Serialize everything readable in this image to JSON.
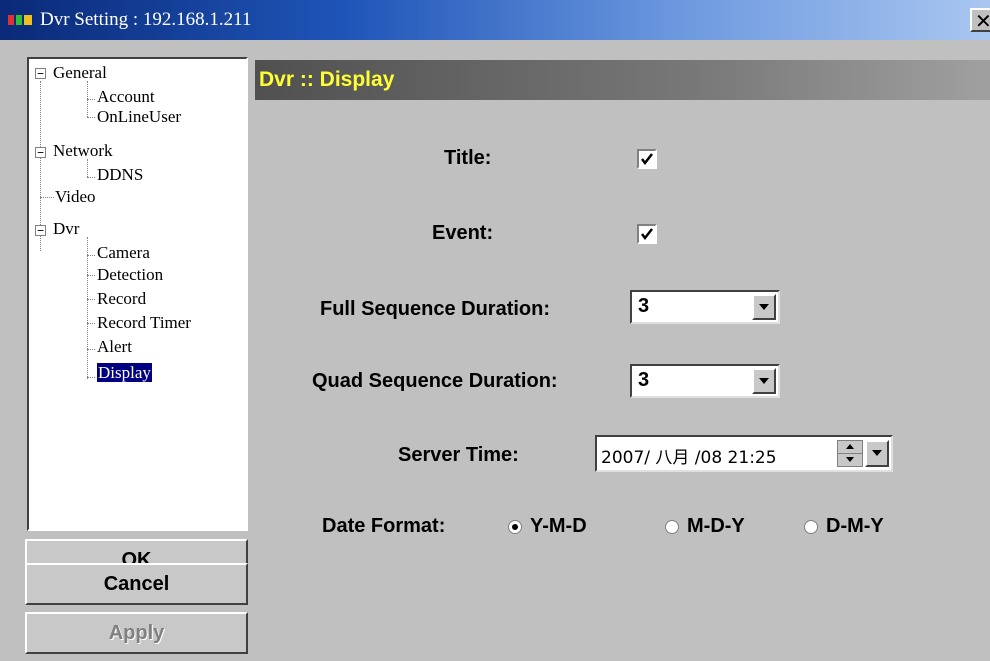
{
  "window": {
    "title": "Dvr Setting : 192.168.1.211",
    "close_glyph": "✕"
  },
  "tree": {
    "items": [
      {
        "label": "General",
        "expander": "−"
      },
      {
        "label": "Account"
      },
      {
        "label": "OnLineUser"
      },
      {
        "label": "Network",
        "expander": "−"
      },
      {
        "label": "DDNS"
      },
      {
        "label": "Video"
      },
      {
        "label": "Dvr",
        "expander": "−"
      },
      {
        "label": "Camera"
      },
      {
        "label": "Detection"
      },
      {
        "label": "Record"
      },
      {
        "label": "Record Timer"
      },
      {
        "label": "Alert"
      },
      {
        "label": "Display",
        "selected": true
      }
    ]
  },
  "buttons": {
    "ok": "OK",
    "cancel": "Cancel",
    "apply": "Apply"
  },
  "panel": {
    "header": "Dvr :: Display",
    "title_label": "Title:",
    "title_checked": true,
    "event_label": "Event:",
    "event_checked": true,
    "full_seq_label": "Full Sequence Duration:",
    "full_seq_value": "3",
    "quad_seq_label": "Quad Sequence Duration:",
    "quad_seq_value": "3",
    "server_time_label": "Server Time:",
    "server_time_value": "2007/ 八月 /08 21:25",
    "date_format_label": "Date Format:",
    "date_format_options": [
      "Y-M-D",
      "M-D-Y",
      "D-M-Y"
    ],
    "date_format_selected": "Y-M-D"
  },
  "colors": {
    "titlebar_start": "#0a2a78",
    "titlebar_end": "#a9c6f0",
    "header_text": "#ffff33",
    "selection": "#000080",
    "face": "#c0c0c0"
  },
  "icons": [
    "app-icon",
    "close-icon",
    "expander-minus-icon",
    "checkmark-icon",
    "dropdown-arrow-icon",
    "spin-up-icon",
    "spin-down-icon"
  ]
}
